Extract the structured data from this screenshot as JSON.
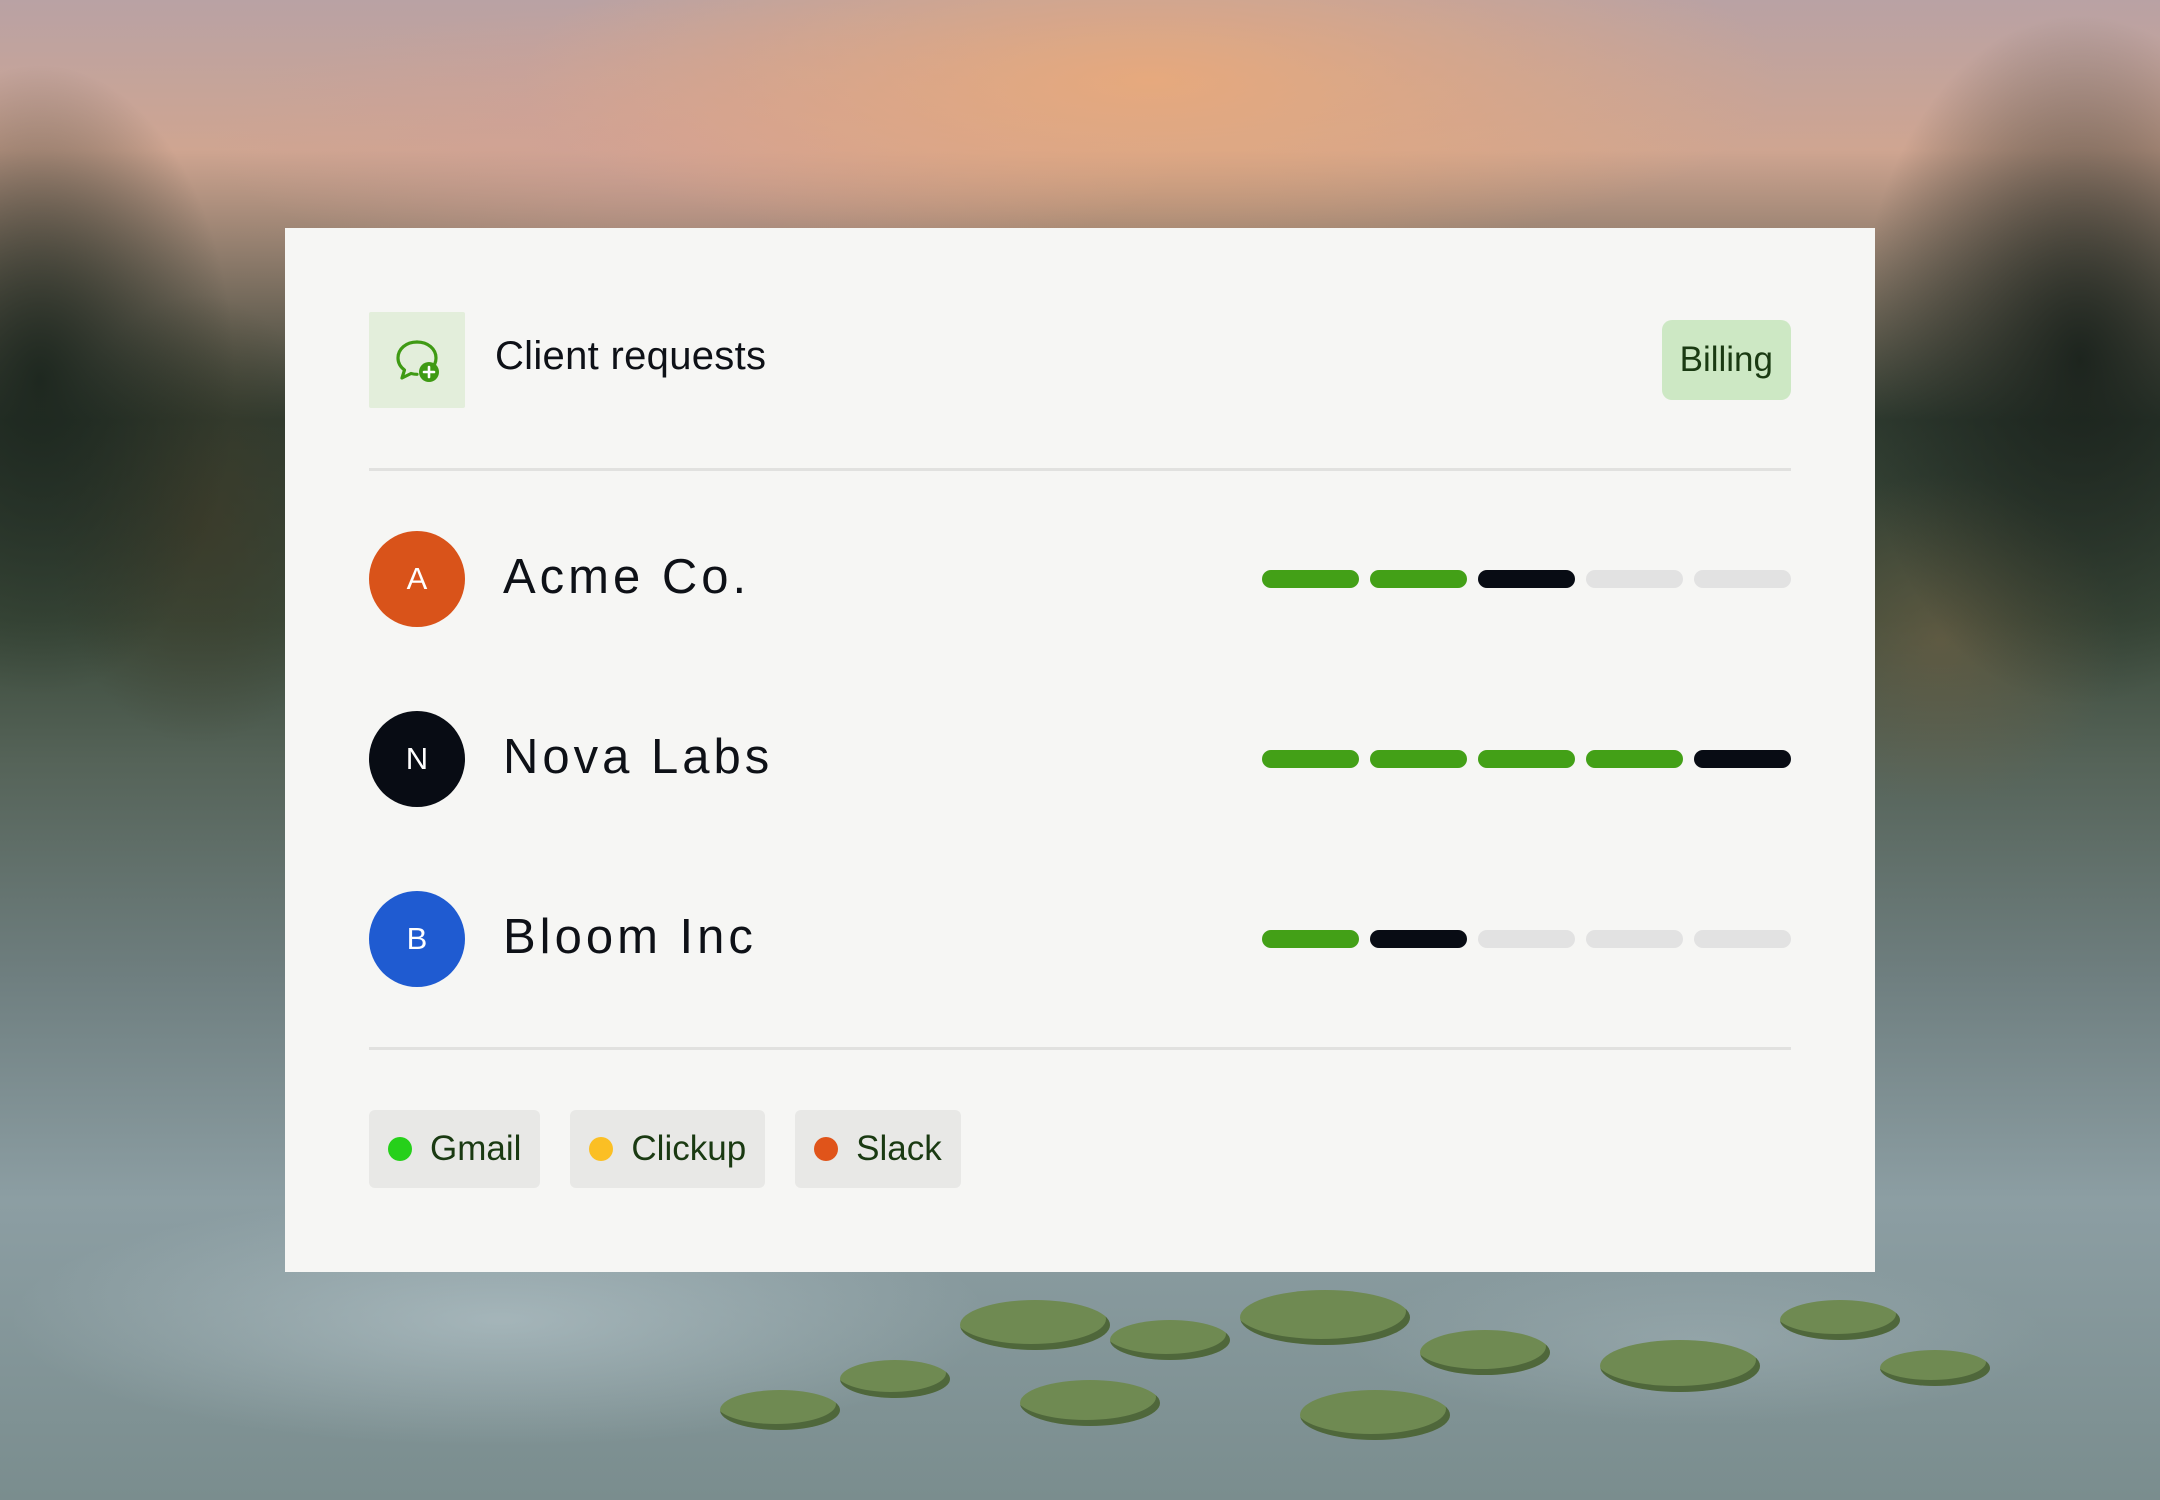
{
  "header": {
    "title": "Client requests",
    "icon": "chat-add-icon",
    "badge": "Billing"
  },
  "clients": [
    {
      "initial": "A",
      "name": "Acme Co.",
      "avatar_color": "#d9531a",
      "progress": {
        "completed": 2,
        "current": 1,
        "total": 5
      }
    },
    {
      "initial": "N",
      "name": "Nova Labs",
      "avatar_color": "#080c14",
      "progress": {
        "completed": 4,
        "current": 1,
        "total": 5
      }
    },
    {
      "initial": "B",
      "name": "Bloom Inc",
      "avatar_color": "#1f5bd1",
      "progress": {
        "completed": 1,
        "current": 1,
        "total": 5
      }
    }
  ],
  "sources": [
    {
      "label": "Gmail",
      "color": "#26d01a"
    },
    {
      "label": "Clickup",
      "color": "#fbbf24"
    },
    {
      "label": "Slack",
      "color": "#e0541a"
    }
  ],
  "colors": {
    "completed": "#43a017",
    "current": "#080c14",
    "pending": "#e2e2e2"
  }
}
